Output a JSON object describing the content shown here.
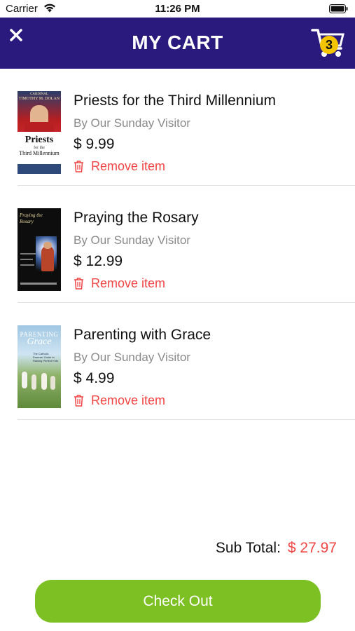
{
  "status_bar": {
    "carrier": "Carrier",
    "time": "11:26 PM"
  },
  "header": {
    "title": "MY CART",
    "cart_count": "3",
    "close_icon": "close-icon",
    "cart_icon": "shopping-cart-icon"
  },
  "items": [
    {
      "title": "Priests for the Third Millennium",
      "author": "By Our Sunday Visitor",
      "price": "$ 9.99",
      "remove_label": "Remove item",
      "cover_text": {
        "top": "CARDINAL",
        "name": "TIMOTHY M. DOLAN",
        "main": "Priests",
        "sub1": "for the",
        "sub2": "Third Millennium"
      }
    },
    {
      "title": "Praying the Rosary",
      "author": "By Our Sunday Visitor",
      "price": "$ 12.99",
      "remove_label": "Remove item",
      "cover_text": {
        "main": "Praying the Rosary"
      }
    },
    {
      "title": "Parenting with Grace",
      "author": "By Our Sunday Visitor",
      "price": "$ 4.99",
      "remove_label": "Remove item",
      "cover_text": {
        "main": "PARENTING",
        "sub": "Grace",
        "tag": "The Catholic Parents' Guide to Raising Perfect Kids"
      }
    }
  ],
  "summary": {
    "subtotal_label": "Sub Total:",
    "subtotal_value": "$ 27.97"
  },
  "checkout_label": "Check Out",
  "colors": {
    "header_bg": "#2a1a7e",
    "accent_red": "#f04545",
    "checkout_green": "#7cc023",
    "badge_yellow": "#f5c400"
  }
}
